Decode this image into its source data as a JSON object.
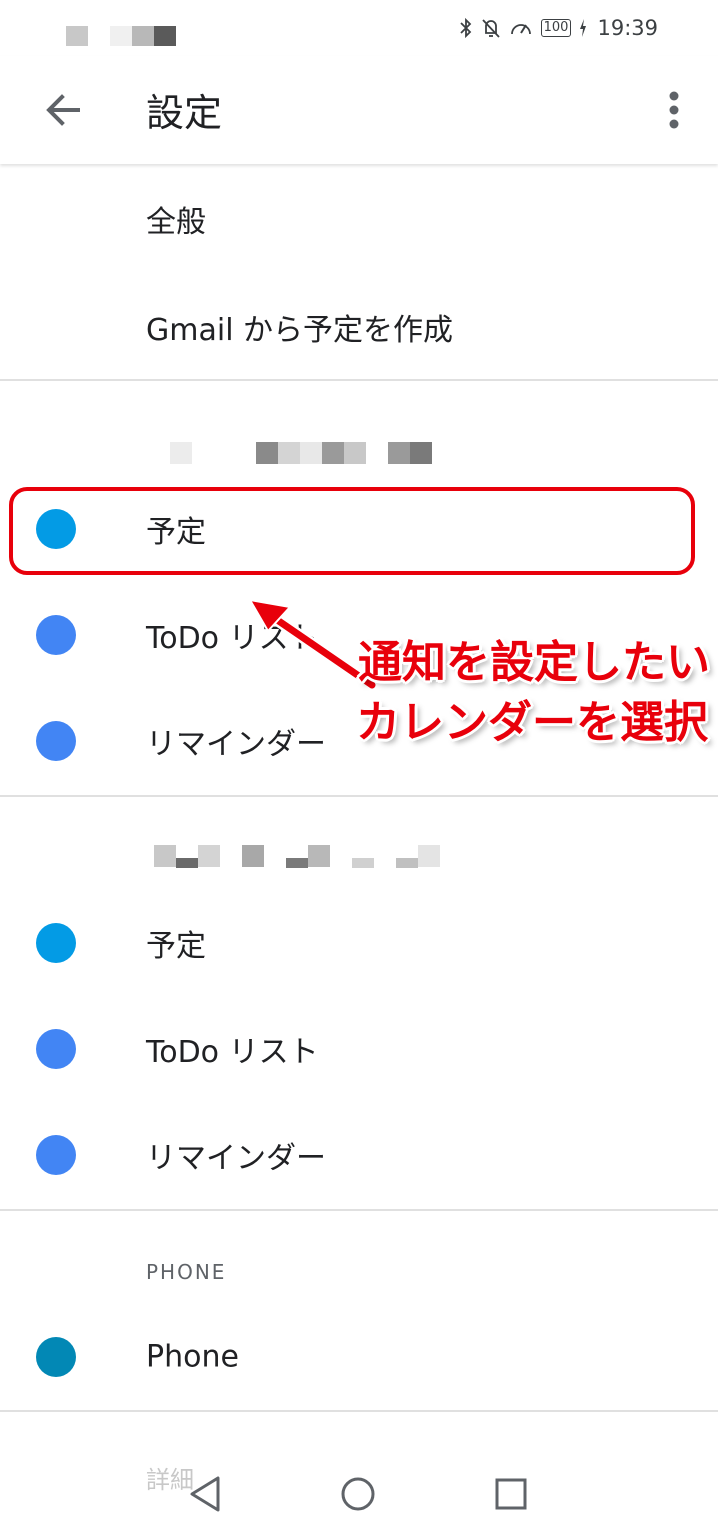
{
  "status_bar": {
    "battery": "100",
    "time": "19:39",
    "icons": [
      "bluetooth-icon",
      "bell-off-icon",
      "speed-icon",
      "battery-icon",
      "charging-icon"
    ]
  },
  "app_bar": {
    "title": "設定",
    "back_icon": "arrow-left-icon",
    "menu_icon": "more-vert-icon"
  },
  "general": {
    "items": [
      "全般",
      "Gmail から予定を作成"
    ]
  },
  "account1": {
    "items": [
      {
        "label": "予定",
        "color": "#039be5"
      },
      {
        "label": "ToDo リスト",
        "color": "#4285f4"
      },
      {
        "label": "リマインダー",
        "color": "#4285f4"
      }
    ]
  },
  "account2": {
    "items": [
      {
        "label": "予定",
        "color": "#039be5"
      },
      {
        "label": "ToDo リスト",
        "color": "#4285f4"
      },
      {
        "label": "リマインダー",
        "color": "#4285f4"
      }
    ]
  },
  "phone_section": {
    "header": "PHONE",
    "items": [
      {
        "label": "Phone",
        "color": "#0288b5"
      }
    ]
  },
  "advanced": {
    "label": "詳細"
  },
  "annotation": {
    "line1": "通知を設定したい",
    "line2": "カレンダーを選択",
    "color": "#e8000b"
  },
  "nav_bar": {
    "icons": [
      "back-triangle-icon",
      "home-circle-icon",
      "recents-square-icon"
    ]
  }
}
